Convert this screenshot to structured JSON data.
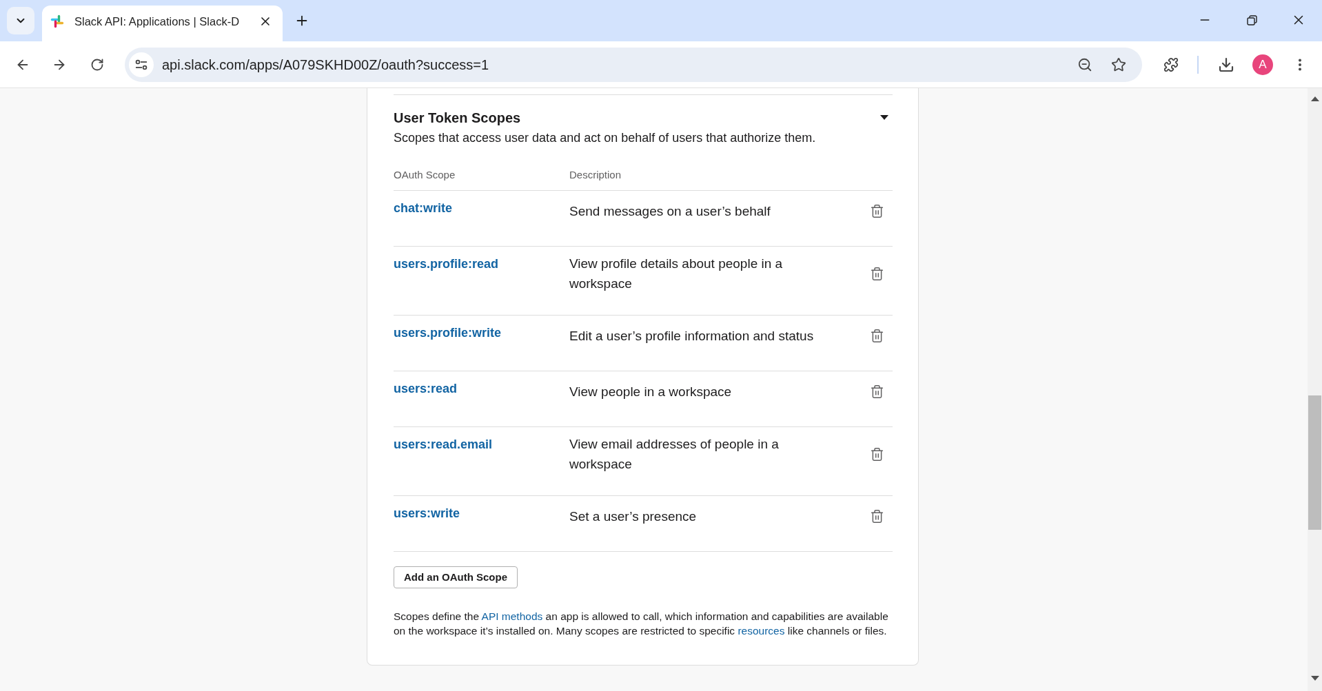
{
  "browser": {
    "tabs": [
      {
        "title": "Slack API: Applications | Slack-D",
        "selected": true
      }
    ],
    "url": "api.slack.com/apps/A079SKHD00Z/oauth?success=1",
    "profile_initial": "A"
  },
  "section": {
    "title": "User Token Scopes",
    "expanded": true,
    "subtitle": "Scopes that access user data and act on behalf of users that authorize them.",
    "columns": [
      "OAuth Scope",
      "Description"
    ],
    "scopes": [
      {
        "name": "chat:write",
        "description": "Send messages on a user’s behalf"
      },
      {
        "name": "users.profile:read",
        "description": "View profile details about people in a workspace"
      },
      {
        "name": "users.profile:write",
        "description": "Edit a user’s profile information and status"
      },
      {
        "name": "users:read",
        "description": "View people in a workspace"
      },
      {
        "name": "users:read.email",
        "description": "View email addresses of people in a workspace"
      },
      {
        "name": "users:write",
        "description": "Set a user’s presence"
      }
    ],
    "add_button": "Add an OAuth Scope",
    "footnote": [
      {
        "kind": "text",
        "text": "Scopes define the "
      },
      {
        "kind": "link",
        "text": "API methods"
      },
      {
        "kind": "text",
        "text": " an app is allowed to call, which information and capabilities are available on the workspace it’s installed on. Many scopes are restricted to specific "
      },
      {
        "kind": "link",
        "text": "resources"
      },
      {
        "kind": "text",
        "text": " like channels or files."
      }
    ]
  }
}
